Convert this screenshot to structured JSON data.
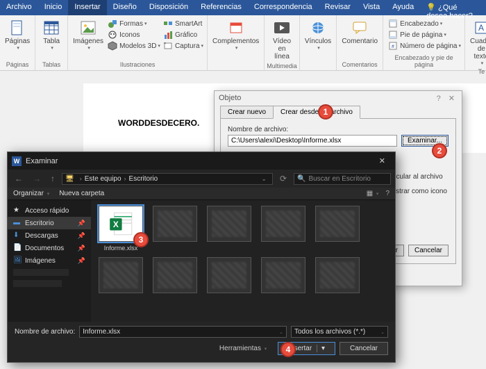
{
  "titleTabs": [
    "Archivo",
    "Inicio",
    "Insertar",
    "Diseño",
    "Disposición",
    "Referencias",
    "Correspondencia",
    "Revisar",
    "Vista",
    "Ayuda"
  ],
  "activeTitleTab": "Insertar",
  "tellMe": "¿Qué desea hacer?",
  "ribbon": {
    "paginas": {
      "btn": "Páginas",
      "group": "Páginas"
    },
    "tablas": {
      "btn": "Tabla",
      "group": "Tablas"
    },
    "ilustr": {
      "img": "Imágenes",
      "formas": "Formas",
      "iconos": "Iconos",
      "m3d": "Modelos 3D",
      "smart": "SmartArt",
      "graf": "Gráfico",
      "capt": "Captura",
      "group": "Ilustraciones"
    },
    "compl": {
      "btn": "Complementos",
      "group": ""
    },
    "media": {
      "btn": "Vídeo en línea",
      "group": "Multimedia"
    },
    "vinc": {
      "btn": "Vínculos",
      "group": ""
    },
    "coment": {
      "btn": "Comentario",
      "group": "Comentarios"
    },
    "hdr": {
      "enc": "Encabezado",
      "pie": "Pie de página",
      "num": "Número de página",
      "group": "Encabezado y pie de página"
    },
    "texto": {
      "cuadro": "Cuadro de texto",
      "group": "Te"
    }
  },
  "docText": "WORDDESDECERO.",
  "objDlg": {
    "title": "Objeto",
    "help": "?",
    "tab1": "Crear nuevo",
    "tab2": "Crear desde un archivo",
    "fileLabel": "Nombre de archivo:",
    "fileValue": "C:\\Users\\alexi\\Desktop\\Informe.xlsx",
    "browse": "Examinar...",
    "link": "Vincular al archivo",
    "icon": "Mostrar como icono",
    "ok": "Aceptar",
    "cancel": "Cancelar"
  },
  "fb": {
    "title": "Examinar",
    "crumb1": "Este equipo",
    "crumb2": "Escritorio",
    "searchPlaceholder": "Buscar en Escritorio",
    "organize": "Organizar",
    "newFolder": "Nueva carpeta",
    "side": {
      "quick": "Acceso rápido",
      "desk": "Escritorio",
      "down": "Descargas",
      "docs": "Documentos",
      "imgs": "Imágenes"
    },
    "selectedFile": "Informe.xlsx",
    "fileLabel": "Nombre de archivo:",
    "fileValue": "Informe.xlsx",
    "filter": "Todos los archivos (*.*)",
    "tools": "Herramientas",
    "insert": "Insertar",
    "cancel": "Cancelar"
  },
  "callouts": {
    "c1": "1",
    "c2": "2",
    "c3": "3",
    "c4": "4"
  }
}
